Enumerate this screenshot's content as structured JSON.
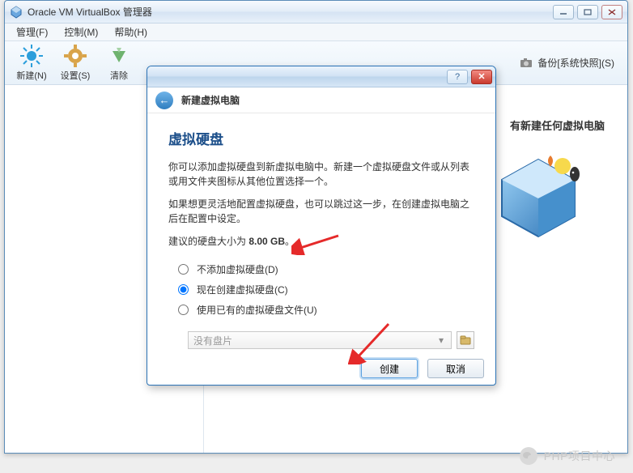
{
  "window": {
    "title": "Oracle VM VirtualBox 管理器"
  },
  "menubar": {
    "items": [
      {
        "label": "管理(F)"
      },
      {
        "label": "控制(M)"
      },
      {
        "label": "帮助(H)"
      }
    ]
  },
  "toolbar": {
    "new": "新建(N)",
    "settings": "设置(S)",
    "discard": "清除",
    "snapshot": "备份[系统快照](S)"
  },
  "right_panel": {
    "empty_msg": "有新建任何虚拟电脑"
  },
  "dialog": {
    "header_title": "新建虚拟电脑",
    "section_title": "虚拟硬盘",
    "para1": "你可以添加虚拟硬盘到新虚拟电脑中。新建一个虚拟硬盘文件或从列表或用文件夹图标从其他位置选择一个。",
    "para2": "如果想更灵活地配置虚拟硬盘，也可以跳过这一步，在创建虚拟电脑之后在配置中设定。",
    "recommend_prefix": "建议的硬盘大小为 ",
    "recommend_size": "8.00 GB",
    "recommend_suffix": "。",
    "radio1": "不添加虚拟硬盘(D)",
    "radio2": "现在创建虚拟硬盘(C)",
    "radio3": "使用已有的虚拟硬盘文件(U)",
    "dropdown_placeholder": "没有盘片",
    "create_btn": "创建",
    "cancel_btn": "取消"
  },
  "watermark": {
    "text": "PHP项目中心"
  }
}
